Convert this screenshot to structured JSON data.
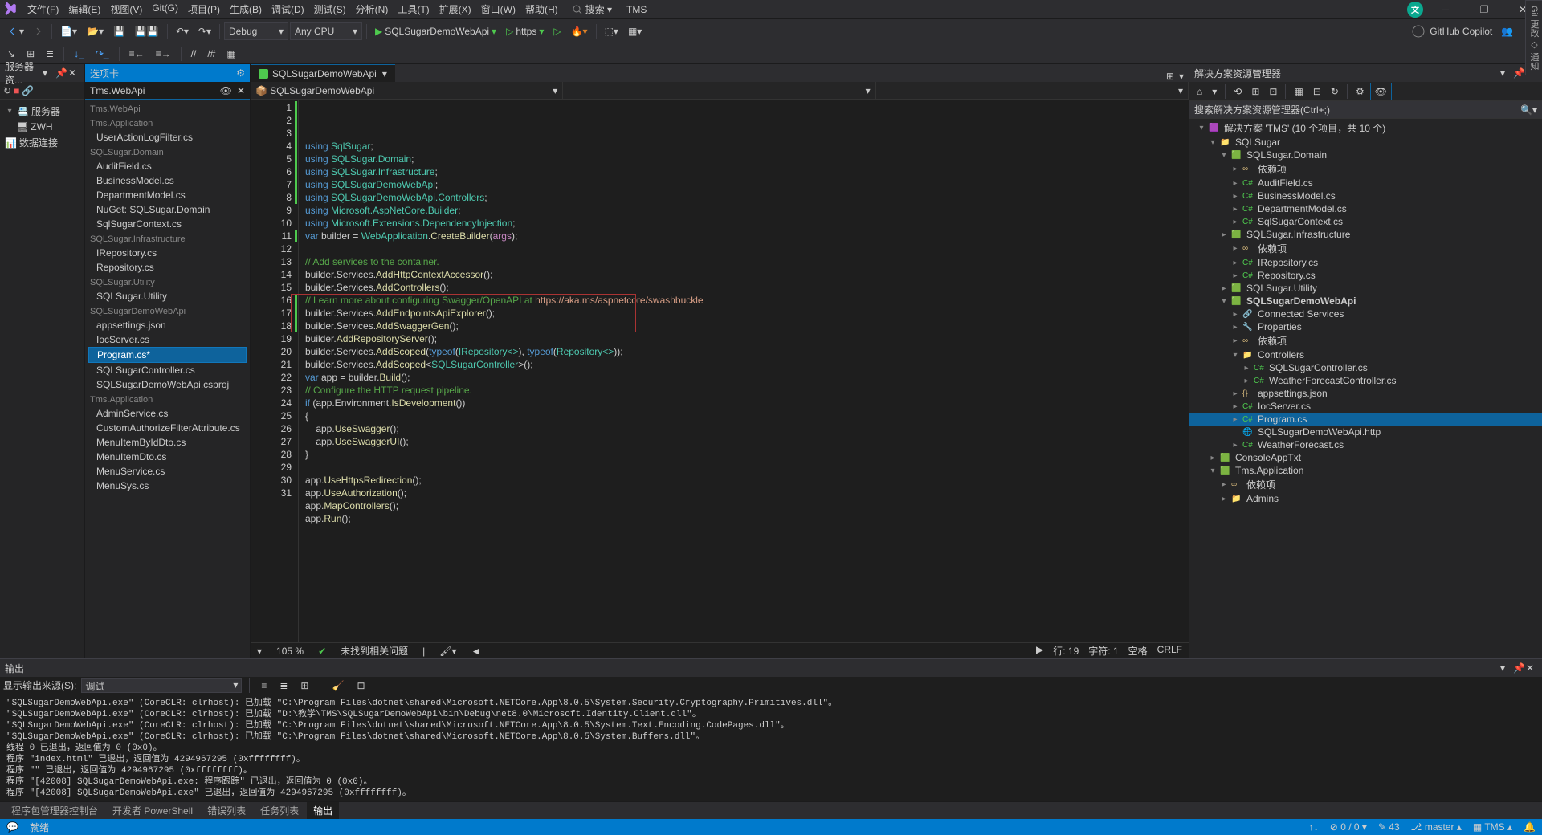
{
  "title": "TMS",
  "menu": [
    "文件(F)",
    "编辑(E)",
    "视图(V)",
    "Git(G)",
    "项目(P)",
    "生成(B)",
    "调试(D)",
    "测试(S)",
    "分析(N)",
    "工具(T)",
    "扩展(X)",
    "窗口(W)",
    "帮助(H)"
  ],
  "search": "搜索 ▾",
  "copilot": "GitHub Copilot",
  "toolbar": {
    "config": "Debug",
    "platform": "Any CPU",
    "startup": "SQLSugarDemoWebApi",
    "https": "https"
  },
  "serverPanel": {
    "title": "服务器资...",
    "nodes": [
      "服务器",
      "ZWH",
      "数据连接"
    ]
  },
  "tabcard": {
    "title": "选项卡",
    "head": "Tms.WebApi",
    "sections": [
      {
        "name": "Tms.WebApi",
        "items": []
      },
      {
        "name": "Tms.Application",
        "items": [
          "UserActionLogFilter.cs"
        ]
      },
      {
        "name": "SQLSugar.Domain",
        "items": [
          "AuditField.cs",
          "BusinessModel.cs",
          "DepartmentModel.cs",
          "NuGet: SQLSugar.Domain",
          "SqlSugarContext.cs"
        ]
      },
      {
        "name": "SQLSugar.Infrastructure",
        "items": [
          "IRepository.cs",
          "Repository.cs"
        ]
      },
      {
        "name": "SQLSugar.Utility",
        "items": [
          "SQLSugar.Utility"
        ]
      },
      {
        "name": "SQLSugarDemoWebApi",
        "items": [
          "appsettings.json",
          "IocServer.cs",
          "Program.cs*",
          "SQLSugarController.cs",
          "SQLSugarDemoWebApi.csproj"
        ]
      },
      {
        "name": "Tms.Application",
        "items": [
          "AdminService.cs",
          "CustomAuthorizeFilterAttribute.cs",
          "MenuItemByIdDto.cs",
          "MenuItemDto.cs",
          "MenuService.cs",
          "MenuSys.cs"
        ]
      }
    ],
    "selected": "Program.cs*"
  },
  "docTab": {
    "active": "SQLSugarDemoWebApi"
  },
  "navbar": [
    "📦 SQLSugarDemoWebApi",
    "",
    ""
  ],
  "code": {
    "lines": [
      {
        "n": 1,
        "seg": [
          [
            "kw",
            "using"
          ],
          [
            "",
            " "
          ],
          [
            "type",
            "SqlSugar"
          ],
          [
            "",
            ";"
          ]
        ]
      },
      {
        "n": 2,
        "seg": [
          [
            "kw",
            "using"
          ],
          [
            "",
            " "
          ],
          [
            "type",
            "SQLSugar.Domain"
          ],
          [
            "",
            ";"
          ]
        ]
      },
      {
        "n": 3,
        "seg": [
          [
            "kw",
            "using"
          ],
          [
            "",
            " "
          ],
          [
            "type",
            "SQLSugar.Infrastructure"
          ],
          [
            "",
            ";"
          ]
        ]
      },
      {
        "n": 4,
        "seg": [
          [
            "kw",
            "using"
          ],
          [
            "",
            " "
          ],
          [
            "type",
            "SQLSugarDemoWebApi"
          ],
          [
            "",
            ";"
          ]
        ]
      },
      {
        "n": 5,
        "seg": [
          [
            "kw",
            "using"
          ],
          [
            "",
            " "
          ],
          [
            "type",
            "SQLSugarDemoWebApi.Controllers"
          ],
          [
            "",
            ";"
          ]
        ]
      },
      {
        "n": 6,
        "seg": [
          [
            "kw",
            "using"
          ],
          [
            "",
            " "
          ],
          [
            "type",
            "Microsoft.AspNetCore.Builder"
          ],
          [
            "",
            ";"
          ]
        ]
      },
      {
        "n": 7,
        "seg": [
          [
            "kw",
            "using"
          ],
          [
            "",
            " "
          ],
          [
            "type",
            "Microsoft.Extensions.DependencyInjection"
          ],
          [
            "",
            ";"
          ]
        ]
      },
      {
        "n": 8,
        "seg": [
          [
            "kw",
            "var"
          ],
          [
            "",
            " builder = "
          ],
          [
            "type",
            "WebApplication"
          ],
          [
            "",
            "."
          ],
          [
            "fn",
            "CreateBuilder"
          ],
          [
            "",
            "("
          ],
          [
            "cspill",
            "args"
          ],
          [
            "",
            ");"
          ]
        ]
      },
      {
        "n": 9,
        "seg": [
          [
            "",
            ""
          ]
        ]
      },
      {
        "n": 10,
        "seg": [
          [
            "cm",
            "// Add services to the container."
          ]
        ]
      },
      {
        "n": 11,
        "seg": [
          [
            "",
            "builder.Services."
          ],
          [
            "fn",
            "AddHttpContextAccessor"
          ],
          [
            "",
            "();"
          ]
        ]
      },
      {
        "n": 12,
        "seg": [
          [
            "",
            "builder.Services."
          ],
          [
            "fn",
            "AddControllers"
          ],
          [
            "",
            "();"
          ]
        ]
      },
      {
        "n": 13,
        "seg": [
          [
            "cm",
            "// Learn more about configuring Swagger/OpenAPI at "
          ],
          [
            "str",
            "https://aka.ms/aspnetcore/swashbuckle"
          ]
        ]
      },
      {
        "n": 14,
        "seg": [
          [
            "",
            "builder.Services."
          ],
          [
            "fn",
            "AddEndpointsApiExplorer"
          ],
          [
            "",
            "();"
          ]
        ]
      },
      {
        "n": 15,
        "seg": [
          [
            "",
            "builder.Services."
          ],
          [
            "fn",
            "AddSwaggerGen"
          ],
          [
            "",
            "();"
          ]
        ]
      },
      {
        "n": 16,
        "seg": [
          [
            "",
            "builder."
          ],
          [
            "fn",
            "AddRepositoryServer"
          ],
          [
            "",
            "();"
          ]
        ]
      },
      {
        "n": 17,
        "seg": [
          [
            "",
            "builder.Services."
          ],
          [
            "fn",
            "AddScoped"
          ],
          [
            "",
            "("
          ],
          [
            "kw",
            "typeof"
          ],
          [
            "",
            "("
          ],
          [
            "type",
            "IRepository<>"
          ],
          [
            "",
            "), "
          ],
          [
            "kw",
            "typeof"
          ],
          [
            "",
            "("
          ],
          [
            "type",
            "Repository<>"
          ],
          [
            "",
            "));"
          ]
        ]
      },
      {
        "n": 18,
        "seg": [
          [
            "",
            "builder.Services."
          ],
          [
            "fn",
            "AddScoped"
          ],
          [
            "",
            "<"
          ],
          [
            "type",
            "SQLSugarController"
          ],
          [
            "",
            ">();"
          ]
        ]
      },
      {
        "n": 19,
        "seg": [
          [
            "kw",
            "var"
          ],
          [
            "",
            " app = builder."
          ],
          [
            "fn",
            "Build"
          ],
          [
            "",
            "();"
          ]
        ]
      },
      {
        "n": 20,
        "seg": [
          [
            "cm",
            "// Configure the HTTP request pipeline."
          ]
        ]
      },
      {
        "n": 21,
        "seg": [
          [
            "kw",
            "if"
          ],
          [
            "",
            " (app.Environment."
          ],
          [
            "fn",
            "IsDevelopment"
          ],
          [
            "",
            "())"
          ]
        ]
      },
      {
        "n": 22,
        "seg": [
          [
            "",
            "{"
          ]
        ]
      },
      {
        "n": 23,
        "seg": [
          [
            "",
            "    app."
          ],
          [
            "fn",
            "UseSwagger"
          ],
          [
            "",
            "();"
          ]
        ]
      },
      {
        "n": 24,
        "seg": [
          [
            "",
            "    app."
          ],
          [
            "fn",
            "UseSwaggerUI"
          ],
          [
            "",
            "();"
          ]
        ]
      },
      {
        "n": 25,
        "seg": [
          [
            "",
            "}"
          ]
        ]
      },
      {
        "n": 26,
        "seg": [
          [
            "",
            ""
          ]
        ]
      },
      {
        "n": 27,
        "seg": [
          [
            "",
            "app."
          ],
          [
            "fn",
            "UseHttpsRedirection"
          ],
          [
            "",
            "();"
          ]
        ]
      },
      {
        "n": 28,
        "seg": [
          [
            "",
            "app."
          ],
          [
            "fn",
            "UseAuthorization"
          ],
          [
            "",
            "();"
          ]
        ]
      },
      {
        "n": 29,
        "seg": [
          [
            "",
            "app."
          ],
          [
            "fn",
            "MapControllers"
          ],
          [
            "",
            "();"
          ]
        ]
      },
      {
        "n": 30,
        "seg": [
          [
            "",
            "app."
          ],
          [
            "fn",
            "Run"
          ],
          [
            "",
            "();"
          ]
        ]
      },
      {
        "n": 31,
        "seg": [
          [
            "",
            ""
          ]
        ]
      }
    ]
  },
  "codeStatus": {
    "zoom": "105 %",
    "issues": "未找到相关问题",
    "line": "行: 19",
    "col": "字符: 1",
    "spc": "空格",
    "eol": "CRLF"
  },
  "sol": {
    "title": "解决方案资源管理器",
    "search": "搜索解决方案资源管理器(Ctrl+;)",
    "tree": [
      {
        "d": 0,
        "e": "▾",
        "i": "sln",
        "t": "解决方案 'TMS' (10 个项目，共 10 个)"
      },
      {
        "d": 1,
        "e": "▾",
        "i": "folder",
        "t": "SQLSugar"
      },
      {
        "d": 2,
        "e": "▾",
        "i": "csproj",
        "t": "SQLSugar.Domain"
      },
      {
        "d": 3,
        "e": "▸",
        "i": "dep",
        "t": "依赖项"
      },
      {
        "d": 3,
        "e": "▸",
        "i": "cs",
        "t": "AuditField.cs"
      },
      {
        "d": 3,
        "e": "▸",
        "i": "cs",
        "t": "BusinessModel.cs"
      },
      {
        "d": 3,
        "e": "▸",
        "i": "cs",
        "t": "DepartmentModel.cs"
      },
      {
        "d": 3,
        "e": "▸",
        "i": "cs",
        "t": "SqlSugarContext.cs"
      },
      {
        "d": 2,
        "e": "▸",
        "i": "csproj",
        "t": "SQLSugar.Infrastructure"
      },
      {
        "d": 3,
        "e": "▸",
        "i": "dep",
        "t": "依赖项"
      },
      {
        "d": 3,
        "e": "▸",
        "i": "cs",
        "t": "IRepository.cs"
      },
      {
        "d": 3,
        "e": "▸",
        "i": "cs",
        "t": "Repository.cs"
      },
      {
        "d": 2,
        "e": "▸",
        "i": "csproj",
        "t": "SQLSugar.Utility"
      },
      {
        "d": 2,
        "e": "▾",
        "i": "csproj",
        "t": "SQLSugarDemoWebApi",
        "bold": true
      },
      {
        "d": 3,
        "e": "▸",
        "i": "conn",
        "t": "Connected Services"
      },
      {
        "d": 3,
        "e": "▸",
        "i": "prop",
        "t": "Properties"
      },
      {
        "d": 3,
        "e": "▸",
        "i": "dep",
        "t": "依赖项"
      },
      {
        "d": 3,
        "e": "▾",
        "i": "folder",
        "t": "Controllers"
      },
      {
        "d": 4,
        "e": "▸",
        "i": "cs",
        "t": "SQLSugarController.cs"
      },
      {
        "d": 4,
        "e": "▸",
        "i": "cs",
        "t": "WeatherForecastController.cs"
      },
      {
        "d": 3,
        "e": "▸",
        "i": "json",
        "t": "appsettings.json"
      },
      {
        "d": 3,
        "e": "▸",
        "i": "cs",
        "t": "IocServer.cs"
      },
      {
        "d": 3,
        "e": "▸",
        "i": "cs",
        "t": "Program.cs",
        "sel": true
      },
      {
        "d": 3,
        "e": " ",
        "i": "http",
        "t": "SQLSugarDemoWebApi.http"
      },
      {
        "d": 3,
        "e": "▸",
        "i": "cs",
        "t": "WeatherForecast.cs"
      },
      {
        "d": 1,
        "e": "▸",
        "i": "csproj",
        "t": "ConsoleAppTxt"
      },
      {
        "d": 1,
        "e": "▾",
        "i": "csproj",
        "t": "Tms.Application"
      },
      {
        "d": 2,
        "e": "▸",
        "i": "dep",
        "t": "依赖项"
      },
      {
        "d": 2,
        "e": "▸",
        "i": "folder",
        "t": "Admins"
      }
    ]
  },
  "output": {
    "title": "输出",
    "from": "显示输出来源(S):",
    "src": "调试",
    "lines": [
      "\"SQLSugarDemoWebApi.exe\" (CoreCLR: clrhost): 已加载 \"C:\\Program Files\\dotnet\\shared\\Microsoft.NETCore.App\\8.0.5\\System.Security.Cryptography.Primitives.dll\"。",
      "\"SQLSugarDemoWebApi.exe\" (CoreCLR: clrhost): 已加载 \"D:\\教学\\TMS\\SQLSugarDemoWebApi\\bin\\Debug\\net8.0\\Microsoft.Identity.Client.dll\"。",
      "\"SQLSugarDemoWebApi.exe\" (CoreCLR: clrhost): 已加载 \"C:\\Program Files\\dotnet\\shared\\Microsoft.NETCore.App\\8.0.5\\System.Text.Encoding.CodePages.dll\"。",
      "\"SQLSugarDemoWebApi.exe\" (CoreCLR: clrhost): 已加载 \"C:\\Program Files\\dotnet\\shared\\Microsoft.NETCore.App\\8.0.5\\System.Buffers.dll\"。",
      "线程 0 已退出，返回值为 0 (0x0)。",
      "程序 \"index.html\" 已退出，返回值为 4294967295 (0xffffffff)。",
      "程序 \"\" 已退出，返回值为 4294967295 (0xffffffff)。",
      "程序 \"[42008] SQLSugarDemoWebApi.exe: 程序跟踪\" 已退出，返回值为 0 (0x0)。",
      "程序 \"[42008] SQLSugarDemoWebApi.exe\" 已退出，返回值为 4294967295 (0xffffffff)。"
    ]
  },
  "bottomTabs": [
    "程序包管理器控制台",
    "开发者 PowerShell",
    "错误列表",
    "任务列表",
    "输出"
  ],
  "statusbar": {
    "ready": "就绪",
    "errors": "0 / 0",
    "warn": "43",
    "branch": "master",
    "proj": "TMS"
  }
}
